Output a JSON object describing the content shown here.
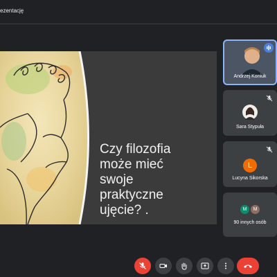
{
  "topbar": {
    "present_label": "ezentację"
  },
  "slide": {
    "text": "Czy filozofia\nmoże mieć\nswoje\npraktyczne\nujęcie?  ."
  },
  "participants": [
    {
      "name": "Andrzej Koniuk",
      "speaking": true
    },
    {
      "name": "Sara Stypuła",
      "muted": true
    },
    {
      "name": "Lucyna Sikorska",
      "muted": true,
      "initial": "L"
    },
    {
      "name": "90 innych osób",
      "avatars": [
        "M",
        "M"
      ]
    }
  ],
  "controls": [
    "mic-off-icon",
    "camera-icon",
    "raise-hand-icon",
    "present-icon",
    "more-icon",
    "hangup-icon"
  ],
  "colors": {
    "background": "#202124",
    "tile": "#3c4043",
    "danger": "#ea4335",
    "accent": "#8ab4f8"
  }
}
